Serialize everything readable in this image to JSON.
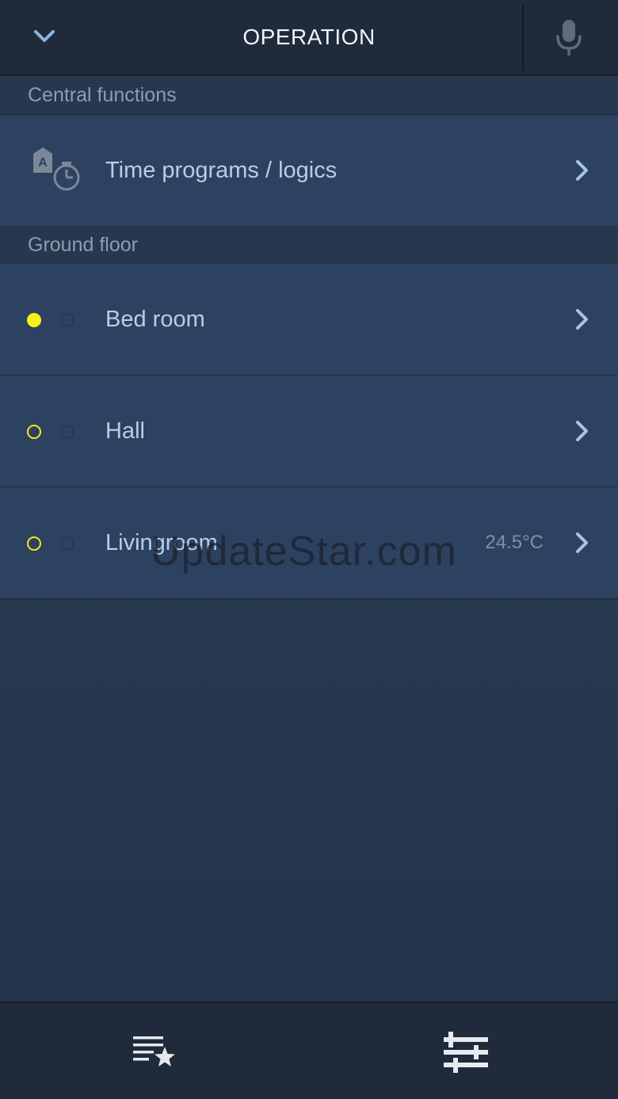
{
  "header": {
    "title": "OPERATION",
    "back_icon": "chevron-down-icon",
    "mic_icon": "microphone-icon"
  },
  "sections": [
    {
      "title": "Central functions",
      "items": [
        {
          "label": "Time programs / logics",
          "icon": "time-program-icon"
        }
      ]
    },
    {
      "title": "Ground floor",
      "items": [
        {
          "label": "Bed room",
          "value": "",
          "status": "on"
        },
        {
          "label": "Hall",
          "value": "",
          "status": "off"
        },
        {
          "label": "Livingroom",
          "value": "24.5°C",
          "status": "off"
        }
      ]
    }
  ],
  "watermark": "UpdateStar.com",
  "footer": {
    "tabs": [
      {
        "name": "favorites",
        "icon": "favorites-list-icon"
      },
      {
        "name": "controls",
        "icon": "sliders-icon"
      }
    ]
  },
  "colors": {
    "header_bg": "#1f2a3a",
    "row_bg": "#2d4260",
    "status_yellow": "#f7f21a",
    "label_text": "#b9cde6"
  }
}
